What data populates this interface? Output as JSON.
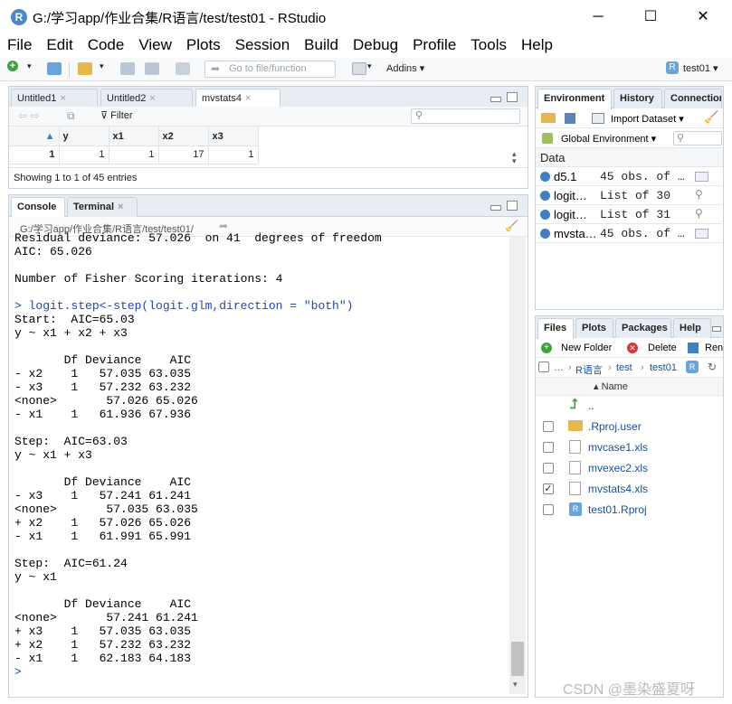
{
  "window": {
    "title": "G:/学习app/作业合集/R语言/test/test01 - RStudio",
    "minimize": "─",
    "maximize": "☐",
    "close": "✕"
  },
  "menu": [
    "File",
    "Edit",
    "Code",
    "View",
    "Plots",
    "Session",
    "Build",
    "Debug",
    "Profile",
    "Tools",
    "Help"
  ],
  "toolbar": {
    "goto_placeholder": "Go to file/function",
    "addins": "Addins",
    "project": "test01"
  },
  "source_pane": {
    "tabs": [
      "Untitled1",
      "Untitled2",
      "mvstats4"
    ],
    "filter_label": "Filter",
    "columns": [
      "y",
      "x1",
      "x2",
      "x3"
    ],
    "row": {
      "index": "1",
      "values": [
        "1",
        "1",
        "17",
        "1"
      ]
    },
    "status": "Showing 1 to 1 of 45 entries"
  },
  "console_pane": {
    "tabs": [
      "Console",
      "Terminal"
    ],
    "path": "G:/学习app/作业合集/R语言/test/test01/",
    "lines": [
      {
        "t": "Residual deviance: 57.026  on 41  degrees of freedom",
        "c": ""
      },
      {
        "t": "AIC: 65.026",
        "c": ""
      },
      {
        "t": "",
        "c": ""
      },
      {
        "t": "Number of Fisher Scoring iterations: 4",
        "c": ""
      },
      {
        "t": "",
        "c": ""
      },
      {
        "t": "> logit.step<-step(logit.glm,direction = \"both\")",
        "c": "cmd"
      },
      {
        "t": "Start:  AIC=65.03",
        "c": ""
      },
      {
        "t": "y ~ x1 + x2 + x3",
        "c": ""
      },
      {
        "t": "",
        "c": ""
      },
      {
        "t": "       Df Deviance    AIC",
        "c": ""
      },
      {
        "t": "- x2    1   57.035 63.035",
        "c": ""
      },
      {
        "t": "- x3    1   57.232 63.232",
        "c": ""
      },
      {
        "t": "<none>       57.026 65.026",
        "c": ""
      },
      {
        "t": "- x1    1   61.936 67.936",
        "c": ""
      },
      {
        "t": "",
        "c": ""
      },
      {
        "t": "Step:  AIC=63.03",
        "c": ""
      },
      {
        "t": "y ~ x1 + x3",
        "c": ""
      },
      {
        "t": "",
        "c": ""
      },
      {
        "t": "       Df Deviance    AIC",
        "c": ""
      },
      {
        "t": "- x3    1   57.241 61.241",
        "c": ""
      },
      {
        "t": "<none>       57.035 63.035",
        "c": ""
      },
      {
        "t": "+ x2    1   57.026 65.026",
        "c": ""
      },
      {
        "t": "- x1    1   61.991 65.991",
        "c": ""
      },
      {
        "t": "",
        "c": ""
      },
      {
        "t": "Step:  AIC=61.24",
        "c": ""
      },
      {
        "t": "y ~ x1",
        "c": ""
      },
      {
        "t": "",
        "c": ""
      },
      {
        "t": "       Df Deviance    AIC",
        "c": ""
      },
      {
        "t": "<none>       57.241 61.241",
        "c": ""
      },
      {
        "t": "+ x3    1   57.035 63.035",
        "c": ""
      },
      {
        "t": "+ x2    1   57.232 63.232",
        "c": ""
      },
      {
        "t": "- x1    1   62.183 64.183",
        "c": ""
      },
      {
        "t": ">",
        "c": "prompt"
      }
    ]
  },
  "env_pane": {
    "tabs": [
      "Environment",
      "History",
      "Connections"
    ],
    "import_label": "Import Dataset",
    "scope": "Global Environment",
    "section": "Data",
    "rows": [
      {
        "name": "d5.1",
        "value": "45 obs. of …",
        "icon": "grid-icon"
      },
      {
        "name": "logit…",
        "value": "List of 30",
        "icon": "search-icon"
      },
      {
        "name": "logit…",
        "value": "List of 31",
        "icon": "search-icon"
      },
      {
        "name": "mvsta…",
        "value": "45 obs. of …",
        "icon": "grid-icon"
      }
    ]
  },
  "files_pane": {
    "tabs": [
      "Files",
      "Plots",
      "Packages",
      "Help"
    ],
    "new_folder": "New Folder",
    "delete": "Delete",
    "rename": "Ren",
    "breadcrumb": [
      "R语言",
      "test",
      "test01"
    ],
    "column_name": "Name",
    "up": "..",
    "files": [
      {
        "name": ".Rproj.user",
        "checked": false,
        "type": "folder"
      },
      {
        "name": "mvcase1.xls",
        "checked": false,
        "type": "file"
      },
      {
        "name": "mvexec2.xls",
        "checked": false,
        "type": "file"
      },
      {
        "name": "mvstats4.xls",
        "checked": true,
        "type": "file"
      },
      {
        "name": "test01.Rproj",
        "checked": false,
        "type": "rproj"
      }
    ]
  },
  "watermark": "CSDN @墨染盛夏呀"
}
